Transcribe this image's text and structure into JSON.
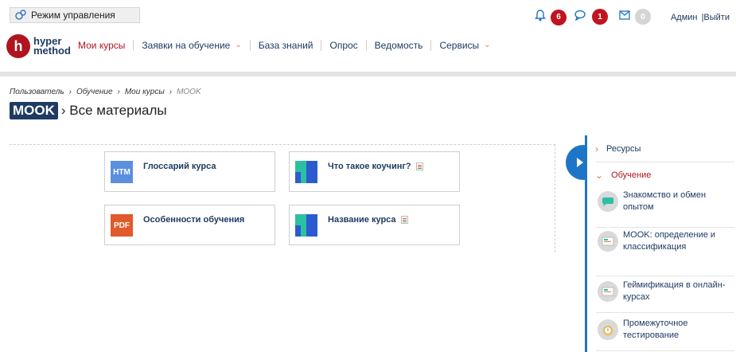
{
  "topbar": {
    "mode_label": "Режим управления",
    "notifications": [
      {
        "icon": "bell-icon",
        "count": "6",
        "color": "#c0141f"
      },
      {
        "icon": "chat-icon",
        "count": "1",
        "color": "#c0141f"
      },
      {
        "icon": "mail-icon",
        "count": "0",
        "color": "#d5d5d5"
      }
    ],
    "user_name": "Админ",
    "logout": "|Выйти"
  },
  "logo": {
    "mark": "h",
    "line1": "hyper",
    "line2": "method"
  },
  "nav": {
    "items": [
      {
        "label": "Мои курсы",
        "has_menu": false
      },
      {
        "label": "Заявки на обучение",
        "has_menu": true
      },
      {
        "label": "База знаний",
        "has_menu": false
      },
      {
        "label": "Опрос",
        "has_menu": false
      },
      {
        "label": "Ведомость",
        "has_menu": false
      },
      {
        "label": "Сервисы",
        "has_menu": true
      }
    ]
  },
  "breadcrumb": [
    "Пользователь",
    "Обучение",
    "Мои курсы",
    "MOOK"
  ],
  "page": {
    "tag": "MOOK",
    "title": "› Все материалы"
  },
  "materials": [
    {
      "label": "Глоссарий курса",
      "type": "HTM"
    },
    {
      "label": "Что такое коучинг?",
      "type": "page"
    },
    {
      "label": "Особенности обучения",
      "type": "PDF"
    },
    {
      "label": "Название курса",
      "type": "page"
    }
  ],
  "sidebar": {
    "sections": [
      {
        "label": "Ресурсы",
        "expanded": false
      },
      {
        "label": "Обучение",
        "expanded": true
      }
    ],
    "items": [
      {
        "label": "Знакомство и обмен опытом"
      },
      {
        "label": "MOOK: определение и классификация"
      },
      {
        "label": "Геймификация в онлайн-курсах"
      },
      {
        "label": "Промежуточное тестирование"
      }
    ]
  }
}
